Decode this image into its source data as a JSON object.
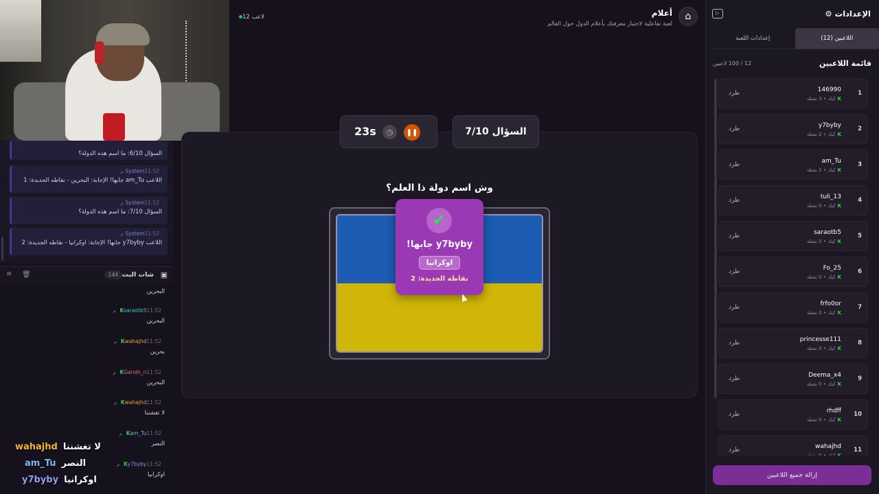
{
  "header": {
    "title": "أعلام",
    "subtitle": "لعبة تفاعلية لاختبار معرفتك بأعلام الدول حول العالم",
    "online": "12 لاعب"
  },
  "events": [
    {
      "author": "System",
      "time": "11:52 م",
      "text": "السؤال 6/10: ما اسم هذه الدولة؟"
    },
    {
      "author": "System",
      "time": "11:52 م",
      "text": "اللاعب am_Tu جابها! الإجابة: البحرين - نقاطه الجديدة: 1"
    },
    {
      "author": "System",
      "time": "11:52 م",
      "text": "السؤال 7/10: ما اسم هذه الدولة؟"
    },
    {
      "author": "System",
      "time": "11:52 م",
      "text": "اللاعب y7byby جابها! الإجابة: اوكرانيا - نقاطه الجديدة: 2"
    }
  ],
  "chat": {
    "title": "شات البث",
    "count": "144",
    "first_text": "البحرين",
    "messages": [
      {
        "user": "saraotb5",
        "color": "#3fc6b9",
        "time": "11:52 م",
        "text": "البحرين"
      },
      {
        "user": "wahajhd",
        "color": "#e0a23a",
        "time": "11:52 م",
        "text": "بحرين"
      },
      {
        "user": "Gandn_n",
        "color": "#e06a7a",
        "time": "11:52 م",
        "text": "البحرين"
      },
      {
        "user": "wahajhd",
        "color": "#e0a23a",
        "time": "11:52 م",
        "text": "لا تغشننا"
      },
      {
        "user": "am_Tu",
        "color": "#7fb0e8",
        "time": "11:52 م",
        "text": "النصر"
      },
      {
        "user": "y7byby",
        "color": "#8c8fe8",
        "time": "11:52 م",
        "text": "اوكرانيا"
      }
    ]
  },
  "overlay_chat": [
    {
      "user": "wahajhd",
      "color": "#f3b23a",
      "text": "لا تغشننا"
    },
    {
      "user": "am_Tu",
      "color": "#7fb8f0",
      "text": "النصر"
    },
    {
      "user": "y7byby",
      "color": "#9a9cf2",
      "text": "اوكرانيا"
    }
  ],
  "game": {
    "question_label": "السؤال 7/10",
    "timer": "23s",
    "question": "وش اسم دولة ذا العلم؟",
    "popup": {
      "who": "y7byby جابها!",
      "answer": "اوكرانيا",
      "points": "نقاطه الجديدة: 2"
    }
  },
  "panel": {
    "title": "الإعدادات",
    "tabs": [
      "اللاعبين (12)",
      "إعدادات اللعبة"
    ],
    "list_title": "قائمة اللاعبين",
    "list_count": "12 / 100 لاعبين",
    "kick_label": "طرد",
    "platform": "كيك",
    "remove_all": "إزالة جميع اللاعبين",
    "players": [
      {
        "num": "1",
        "name": "146990",
        "points": "3 نقطة"
      },
      {
        "num": "2",
        "name": "y7byby",
        "points": "2 نقطة"
      },
      {
        "num": "3",
        "name": "am_Tu",
        "points": "1 نقطة"
      },
      {
        "num": "4",
        "name": "tuli_13",
        "points": "0 نقطة"
      },
      {
        "num": "5",
        "name": "saraotb5",
        "points": "0 نقطة"
      },
      {
        "num": "6",
        "name": "Fo_25",
        "points": "0 نقطة"
      },
      {
        "num": "7",
        "name": "frfo0or",
        "points": "0 نقطة"
      },
      {
        "num": "8",
        "name": "princesse111",
        "points": "0 نقطة"
      },
      {
        "num": "9",
        "name": "Deema_x4",
        "points": "0 نقطة"
      },
      {
        "num": "10",
        "name": "rhdff",
        "points": "0 نقطة"
      },
      {
        "num": "11",
        "name": "wahajhd",
        "points": "0 نقطة"
      }
    ]
  }
}
